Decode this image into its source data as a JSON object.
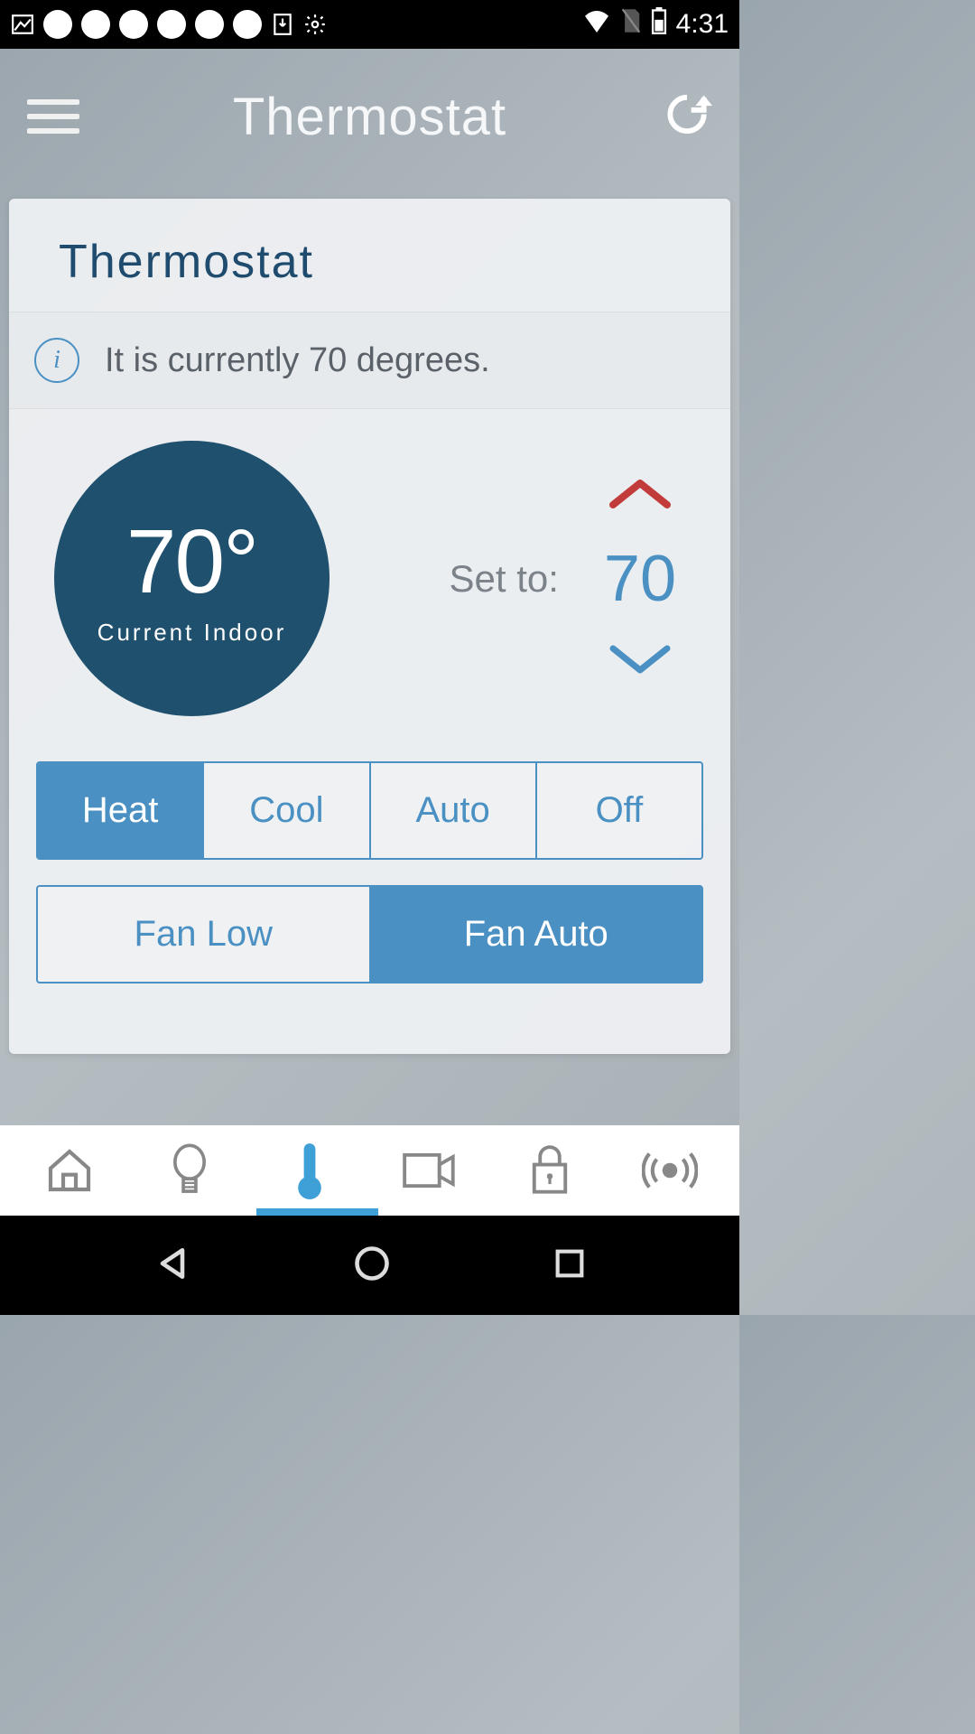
{
  "status_bar": {
    "time": "4:31"
  },
  "header": {
    "title": "Thermostat"
  },
  "card": {
    "title": "Thermostat",
    "info_text": "It is currently 70 degrees.",
    "current_temp": "70°",
    "current_label": "Current Indoor",
    "set_label": "Set to:",
    "set_value": "70"
  },
  "modes": {
    "items": [
      "Heat",
      "Cool",
      "Auto",
      "Off"
    ],
    "active": 0
  },
  "fan": {
    "items": [
      "Fan Low",
      "Fan Auto"
    ],
    "active": 1
  }
}
